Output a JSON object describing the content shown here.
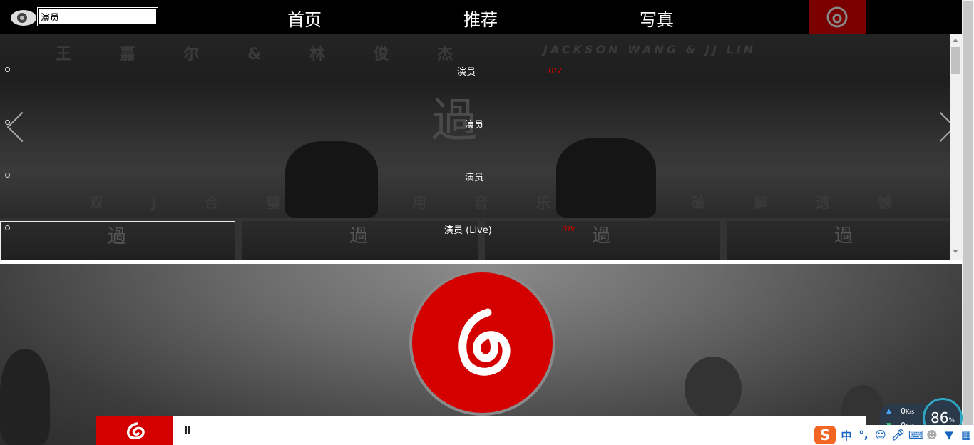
{
  "search": {
    "value": "演员"
  },
  "nav": {
    "items": [
      "首页",
      "推荐",
      "写真"
    ]
  },
  "banner": {
    "top_text_cn": "王 嘉 尔 & 林 俊 杰",
    "top_text_en": "JACKSON WANG & JJ LIN",
    "big_char": "過",
    "bottom_text_left": "双 J 合 璧",
    "bottom_text_mid": "用 音 乐",
    "bottom_text_right": "破 解 遗 憾",
    "thumb_char": "過"
  },
  "songs": [
    {
      "title": "演员",
      "mv": "mv"
    },
    {
      "title": "演员",
      "mv": ""
    },
    {
      "title": "演员",
      "mv": ""
    },
    {
      "title": "演员 (Live)",
      "mv": "mv"
    }
  ],
  "tray": {
    "upload_speed": "0",
    "download_speed": "0",
    "speed_unit": "K/s",
    "gauge_value": "86",
    "gauge_unit": "%",
    "ime_logo": "S",
    "ime_mode": "中",
    "ime_punct": "°,"
  },
  "colors": {
    "accent_red": "#d40000",
    "dark_red": "#7a0000",
    "mv_red": "#d00000"
  }
}
